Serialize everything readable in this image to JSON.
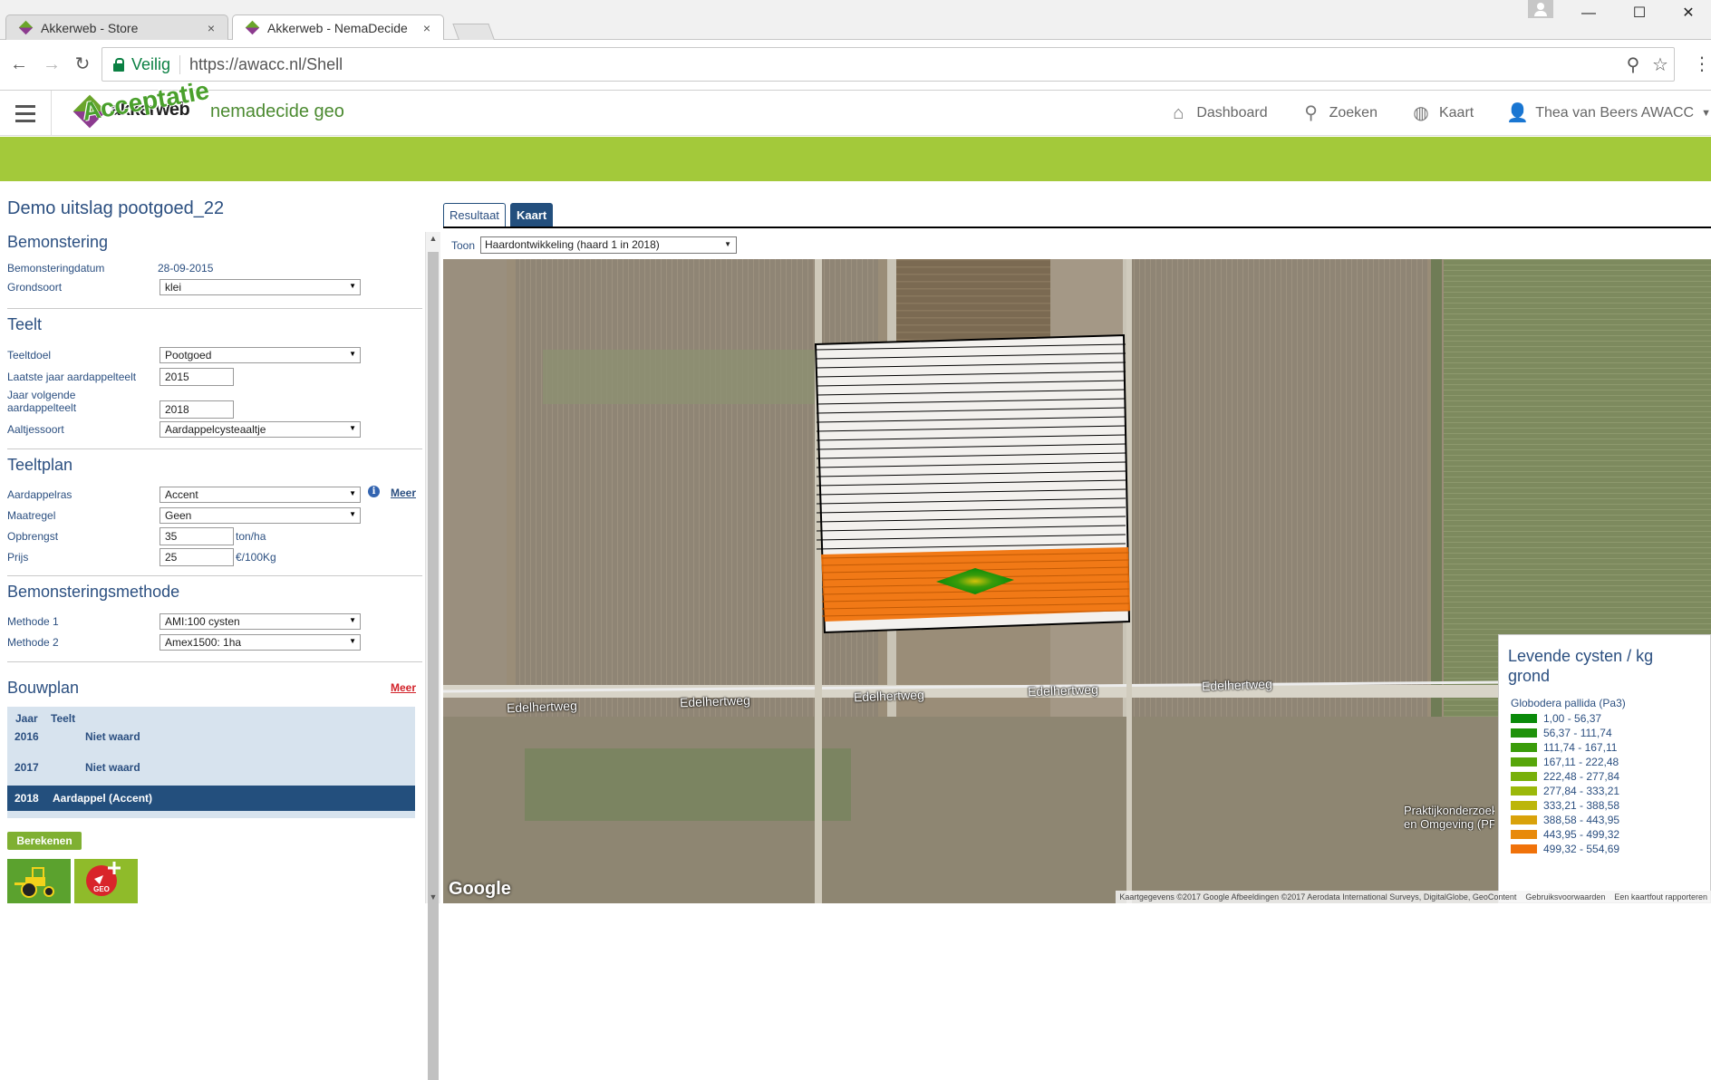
{
  "browser": {
    "tabs": [
      {
        "title": "Akkerweb - Store",
        "close": "×"
      },
      {
        "title": "Akkerweb - NemaDecide",
        "close": "×"
      }
    ],
    "window_controls": {
      "minimize": "—",
      "maximize": "☐",
      "close": "✕"
    },
    "nav": {
      "back": "←",
      "forward": "→",
      "reload": "↻"
    },
    "secure_label": "Veilig",
    "url": "https://awacc.nl/Shell",
    "icons": [
      "lock-icon",
      "zoom-icon",
      "star-icon",
      "menu-dots-icon"
    ]
  },
  "app": {
    "logo_text": "akkerweb",
    "stamp": "Acceptatie",
    "name": "nemadecide geo",
    "nav": [
      {
        "label": "Dashboard",
        "icon": "home-icon"
      },
      {
        "label": "Zoeken",
        "icon": "search-icon"
      },
      {
        "label": "Kaart",
        "icon": "globe-icon"
      },
      {
        "label": "Thea van Beers AWACC",
        "icon": "user-icon"
      }
    ],
    "accent_color": "#a3c93a",
    "brand_blue": "#2b4f80"
  },
  "page_title": "Demo uitslag pootgoed_22",
  "bemonstering": {
    "title": "Bemonstering",
    "datum_label": "Bemonsteringdatum",
    "datum_value": "28-09-2015",
    "grondsoort_label": "Grondsoort",
    "grondsoort_value": "klei"
  },
  "teelt": {
    "title": "Teelt",
    "teeltdoel_label": "Teeltdoel",
    "teeltdoel_value": "Pootgoed",
    "laatste_jaar_label": "Laatste jaar aardappelteelt",
    "laatste_jaar_value": "2015",
    "volgend_jaar_label_1": "Jaar volgende",
    "volgend_jaar_label_2": "aardappelteelt",
    "volgend_jaar_value": "2018",
    "aaltjessoort_label": "Aaltjessoort",
    "aaltjessoort_value": "Aardappelcysteaaltje"
  },
  "teeltplan": {
    "title": "Teeltplan",
    "ras_label": "Aardappelras",
    "ras_value": "Accent",
    "info": "i",
    "meer": "Meer",
    "maatregel_label": "Maatregel",
    "maatregel_value": "Geen",
    "opbrengst_label": "Opbrengst",
    "opbrengst_value": "35",
    "opbrengst_unit": "ton/ha",
    "prijs_label": "Prijs",
    "prijs_value": "25",
    "prijs_unit": "€/100Kg"
  },
  "methode": {
    "title": "Bemonsteringsmethode",
    "m1_label": "Methode 1",
    "m1_value": "AMI:100 cysten",
    "m2_label": "Methode 2",
    "m2_value": "Amex1500: 1ha"
  },
  "bouwplan": {
    "title": "Bouwplan",
    "meer": "Meer",
    "col_jaar": "Jaar",
    "col_teelt": "Teelt",
    "rows": [
      {
        "jaar": "2016",
        "teelt": "Niet waard",
        "selected": false
      },
      {
        "jaar": "2017",
        "teelt": "Niet waard",
        "selected": false
      },
      {
        "jaar": "2018",
        "teelt": "Aardappel (Accent)",
        "selected": true
      }
    ]
  },
  "berekenen": "Berekenen",
  "tiles": [
    {
      "icon": "tractor-icon"
    },
    {
      "icon": "geo-icon",
      "label": "GEO"
    }
  ],
  "scrollbar": {
    "up": "▲",
    "down": "▼"
  },
  "result_tabs": {
    "resultaat": "Resultaat",
    "kaart": "Kaart"
  },
  "toon": {
    "label": "Toon",
    "value": "Haardontwikkeling (haard 1 in 2018)"
  },
  "map": {
    "road_labels": [
      "Edelhertweg",
      "Edelhertweg",
      "Edelhertweg",
      "Edelhertweg",
      "Edelhertweg"
    ],
    "place_label_1": "Praktijkonderzoek Pla",
    "place_label_2": "en Omgeving (PP",
    "google": "Google",
    "attribution": "Kaartgegevens ©2017 Google Afbeeldingen ©2017 Aerodata International Surveys, DigitalGlobe, GeoContent",
    "terms": "Gebruiksvoorwaarden",
    "report": "Een kaartfout rapporteren"
  },
  "legend": {
    "title": "Levende cysten / kg grond",
    "subtitle": "Globodera pallida (Pa3)",
    "items": [
      {
        "label": "1,00 - 56,37",
        "color": "#0a8a0a"
      },
      {
        "label": "56,37 - 111,74",
        "color": "#1f920a"
      },
      {
        "label": "111,74 - 167,11",
        "color": "#3a9c0a"
      },
      {
        "label": "167,11 - 222,48",
        "color": "#57a60a"
      },
      {
        "label": "222,48 - 277,84",
        "color": "#78b00a"
      },
      {
        "label": "277,84 - 333,21",
        "color": "#9bb80a"
      },
      {
        "label": "333,21 - 388,58",
        "color": "#bcb60a"
      },
      {
        "label": "388,58 - 443,95",
        "color": "#d9a20a"
      },
      {
        "label": "443,95 - 499,32",
        "color": "#e88a0a"
      },
      {
        "label": "499,32 - 554,69",
        "color": "#f0720a"
      }
    ]
  }
}
